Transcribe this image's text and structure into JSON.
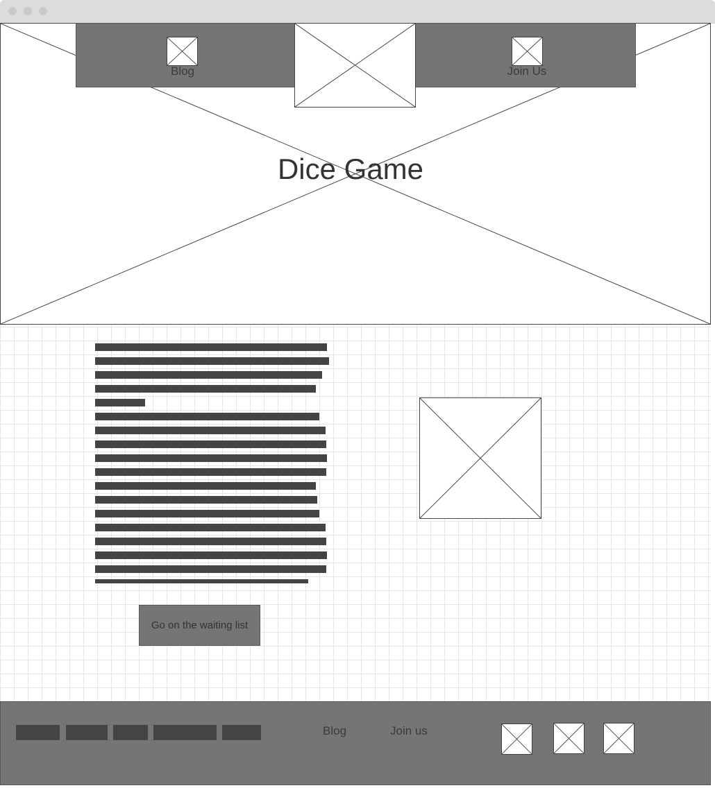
{
  "hero": {
    "title": "Dice Game",
    "nav": [
      {
        "label": "Blog"
      },
      {
        "label": "Join Us"
      }
    ]
  },
  "main": {
    "cta_label": "Go on the waiting list"
  },
  "footer": {
    "links": [
      {
        "label": "Blog"
      },
      {
        "label": "Join us"
      }
    ],
    "social_icons": [
      "image-placeholder-icon",
      "image-placeholder-icon",
      "image-placeholder-icon"
    ]
  },
  "colors": {
    "nav_bg": "#757575",
    "text_bar": "#444444",
    "grid_line": "#e6e6e6"
  }
}
